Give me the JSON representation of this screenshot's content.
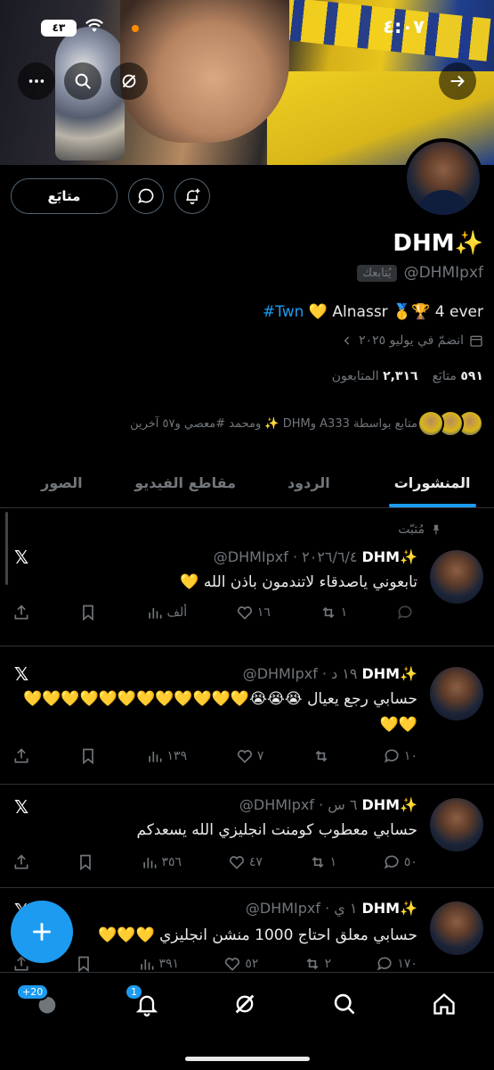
{
  "status_bar": {
    "time": "٤:٠٧",
    "battery": "٤٣"
  },
  "profile": {
    "name": "DHM✨",
    "handle": "@DHMIpxf",
    "follows_you": "يُتابعك",
    "bio_prefix": "",
    "bio_tag": "#Twn",
    "bio_rest": "💛 Alnassr 🥇🏆 4 ever",
    "joined": "انضمّ في يوليو ٢٠٢٥",
    "following_count": "٥٩١",
    "following_label": "متابَع",
    "followers_count": "٢,٣١٦",
    "followers_label": "المتابعون",
    "followed_by": "متابع بواسطة A333 وDHM ✨ ومحمد #معصي و٥٧ آخرين",
    "follow_button": "متابَع"
  },
  "tabs": [
    "المنشورات",
    "الردود",
    "مقاطع الفيديو",
    "الصور"
  ],
  "pinned_label": "مُثبّت",
  "tweets": [
    {
      "name": "DHM✨",
      "meta": "@DHMIpxf · ٢٠٢٦/٦/٤",
      "text": "تابعوني ياصدقاء لاتندمون باذن الله 💛",
      "replies": "",
      "retweets": "١",
      "likes": "١٦",
      "views": "ألف"
    },
    {
      "name": "DHM✨",
      "meta": "@DHMIpxf · ١٩ د",
      "text": "حسابي رجع يعيال 😭😭😭💛💛💛💛💛💛💛💛💛💛💛💛💛💛",
      "replies": "١٠",
      "retweets": "",
      "likes": "٧",
      "views": "١٣٩"
    },
    {
      "name": "DHM✨",
      "meta": "@DHMIpxf · ٦ س",
      "text": "حسابي معطوب كومنت انجليزي الله يسعدكم",
      "replies": "٥٠",
      "retweets": "١",
      "likes": "٤٧",
      "views": "٣٥٦"
    },
    {
      "name": "DHM✨",
      "meta": "@DHMIpxf · ١ ي",
      "text": "حسابي معلق احتاج 1000 منشن انجليزي 💛💛💛",
      "replies": "١٧٠",
      "retweets": "٢",
      "likes": "٥٢",
      "views": "٣٩١"
    }
  ],
  "nav": {
    "messages_badge": "+20",
    "notifications_badge": "1"
  },
  "colors": {
    "accent": "#1d9bf0",
    "background": "#000000",
    "muted": "#71767b"
  }
}
